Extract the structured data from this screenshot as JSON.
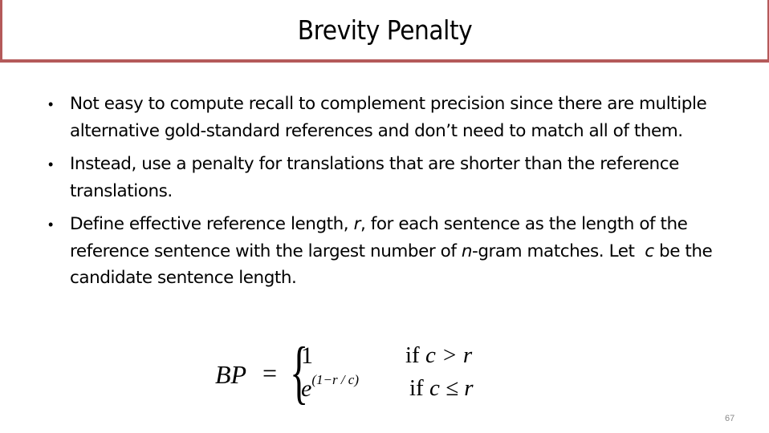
{
  "slide": {
    "title": "Brevity Penalty",
    "accent_color": "#b45a5a",
    "bullets": [
      {
        "segments": [
          "Not easy to compute recall to complement precision since there are multiple alternative gold-standard references and don’t need to match all of them."
        ]
      },
      {
        "segments": [
          "Instead, use a penalty for translations that are shorter than the reference translations."
        ]
      },
      {
        "segments": [
          "Define effective reference length, ",
          "r",
          ", for each sentence as the length of the reference sentence with the largest number of ",
          "n",
          "-gram matches. Let  ",
          "c",
          " be the candidate sentence length."
        ]
      }
    ],
    "formula": {
      "lhs": "BP",
      "equals": "=",
      "case1_value": "1",
      "case1_condition_prefix": "if ",
      "case1_condition": "c > r",
      "case2_base": "e",
      "case2_exponent": "(1−r / c)",
      "case2_condition_prefix": "if ",
      "case2_condition": "c ≤ r"
    },
    "page_number": "67"
  }
}
